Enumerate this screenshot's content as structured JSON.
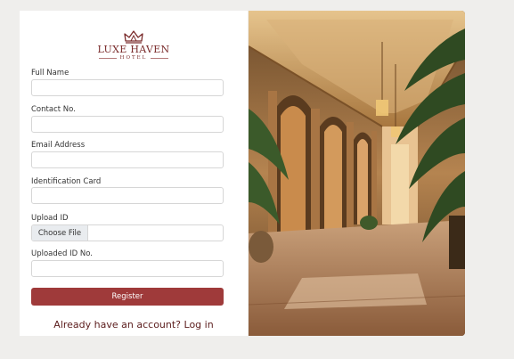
{
  "brand": {
    "name": "LUXE HAVEN",
    "subtitle": "HOTEL"
  },
  "form": {
    "fields": [
      {
        "label": "Full Name",
        "value": ""
      },
      {
        "label": "Contact No.",
        "value": ""
      },
      {
        "label": "Email Address",
        "value": ""
      },
      {
        "label": "Identification Card",
        "value": ""
      },
      {
        "label": "Upload ID",
        "button": "Choose File"
      },
      {
        "label": "Uploaded ID No.",
        "value": ""
      }
    ],
    "submit_label": "Register",
    "login_prompt": "Already have an account? Log in"
  },
  "colors": {
    "accent": "#9f3a3a",
    "brand": "#7a2b2b",
    "background": "#efeeec"
  },
  "image": {
    "subject": "hotel lobby colonnade photo"
  }
}
